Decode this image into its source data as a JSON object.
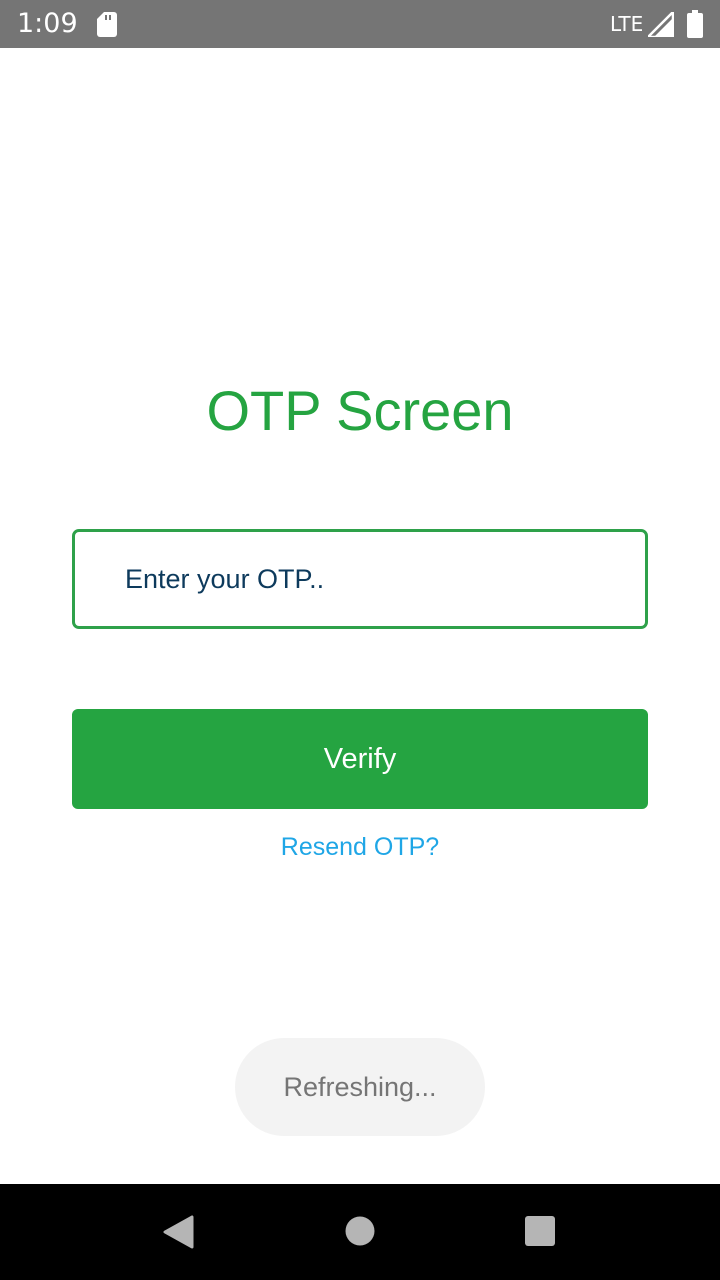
{
  "status_bar": {
    "time": "1:09",
    "network": "LTE",
    "icons": [
      "sd-card-icon",
      "signal-icon",
      "battery-icon"
    ]
  },
  "main": {
    "title": "OTP Screen",
    "otp_input": {
      "placeholder": "Enter your OTP..",
      "value": ""
    },
    "verify_label": "Verify",
    "resend_label": "Resend OTP?"
  },
  "toast": {
    "text": "Refreshing..."
  },
  "nav_bar": {
    "icons": [
      "back-icon",
      "home-icon",
      "recents-icon"
    ]
  },
  "colors": {
    "accent_green": "#25a441",
    "link_blue": "#1fa6e6",
    "status_bar_gray": "#757575",
    "input_text": "#0d3a5c"
  }
}
